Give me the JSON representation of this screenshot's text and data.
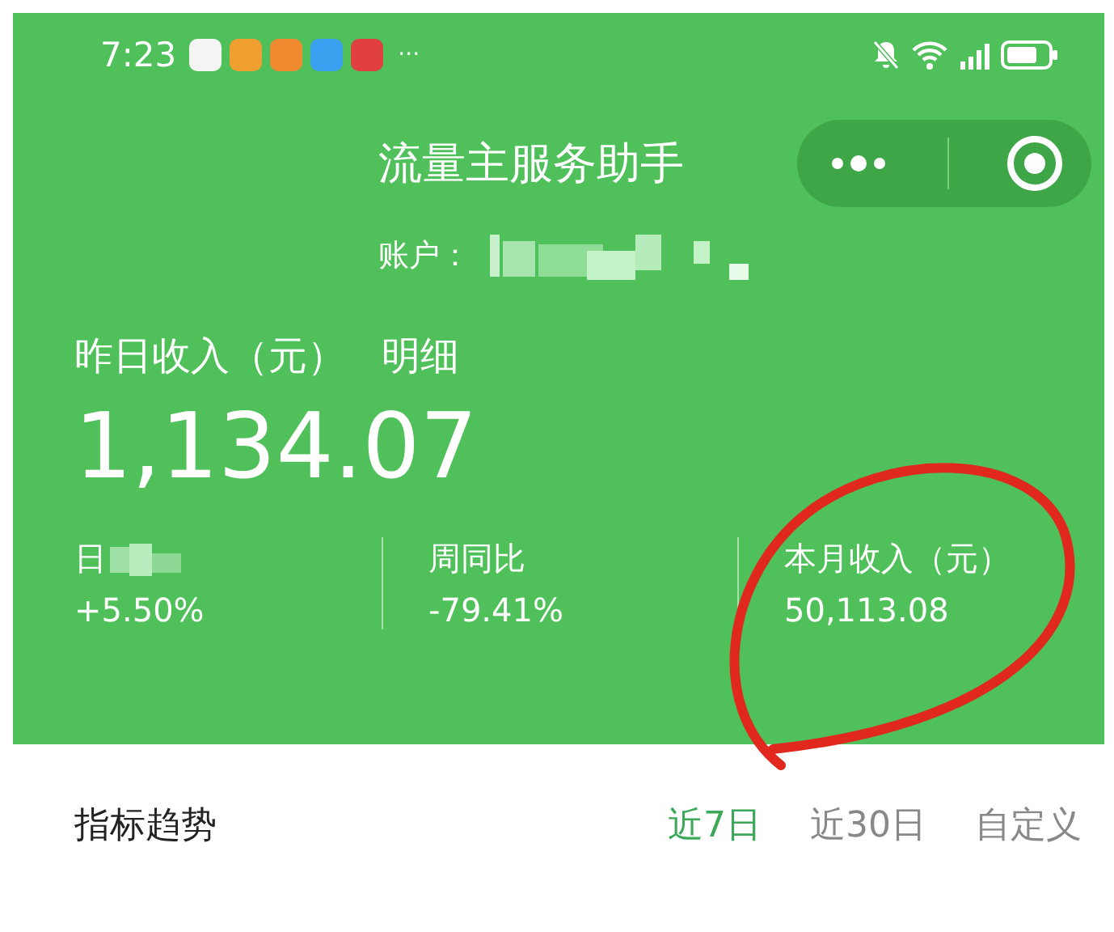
{
  "status_bar": {
    "time": "7:23",
    "more": "···"
  },
  "header": {
    "title": "流量主服务助手",
    "account_label": "账户：",
    "account_redacted": true
  },
  "income": {
    "label": "昨日收入（元）",
    "detail_link": "明细",
    "amount": "1,134.07"
  },
  "stats": [
    {
      "label": "日",
      "redacted": true,
      "value": "+5.50%"
    },
    {
      "label": "周同比",
      "redacted": false,
      "value": "-79.41%"
    },
    {
      "label": "本月收入（元）",
      "redacted": false,
      "value": "50,113.08"
    }
  ],
  "annotation": {
    "kind": "circle"
  },
  "trend": {
    "title": "指标趋势",
    "ranges": [
      {
        "label": "近7日",
        "selected": true
      },
      {
        "label": "近30日",
        "selected": false
      },
      {
        "label": "自定义",
        "selected": false
      }
    ]
  }
}
